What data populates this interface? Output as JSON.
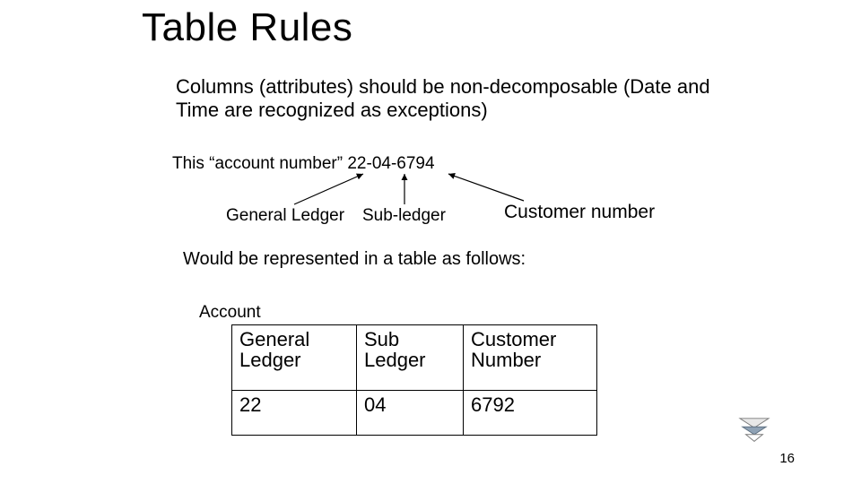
{
  "title": "Table Rules",
  "body": "Columns (attributes) should be non-decomposable (Date and Time are recognized as exceptions)",
  "example_line": "This “account number” 22-04-6794",
  "labels": {
    "general_ledger": "General Ledger",
    "sub_ledger": "Sub-ledger",
    "customer_number": "Customer number"
  },
  "follows": "Would be represented in a table as follows:",
  "table": {
    "caption": "Account",
    "headers": [
      "General\nLedger",
      "Sub\nLedger",
      "Customer\nNumber"
    ],
    "row": [
      "22",
      "04",
      "6792"
    ]
  },
  "page_number": "16"
}
